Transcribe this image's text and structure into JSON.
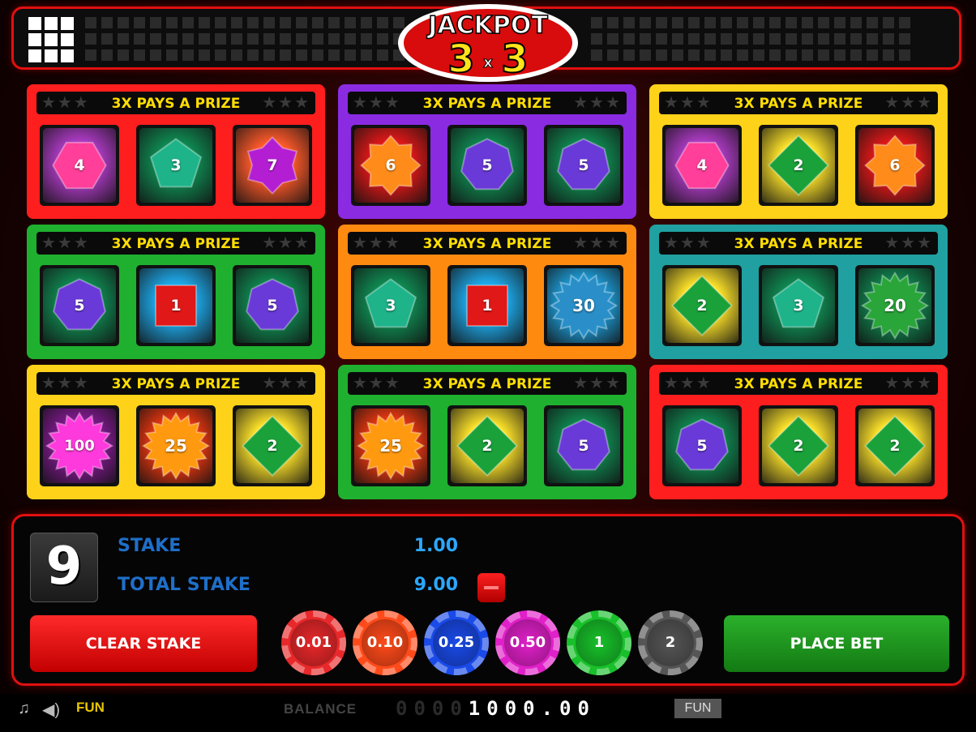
{
  "logo": {
    "line1": "JACKPOT",
    "line2a": "3",
    "line2x": "x",
    "line2b": "3"
  },
  "prize_text": "3X PAYS A PRIZE",
  "cards": [
    {
      "frame": "#ff1e1e",
      "cells": [
        {
          "shape": "hexagon",
          "color": "#ff3f9a",
          "value": "4"
        },
        {
          "shape": "pentagon",
          "color": "#1fb38a",
          "value": "3"
        },
        {
          "shape": "octagon",
          "color": "#b41ed2",
          "value": "7"
        }
      ]
    },
    {
      "frame": "#8a2be2",
      "cells": [
        {
          "shape": "star8",
          "color": "#ff8c1a",
          "value": "6"
        },
        {
          "shape": "heptagon",
          "color": "#6a3ad8",
          "value": "5"
        },
        {
          "shape": "heptagon",
          "color": "#6a3ad8",
          "value": "5"
        }
      ]
    },
    {
      "frame": "#ffd21a",
      "cells": [
        {
          "shape": "hexagon",
          "color": "#ff3f9a",
          "value": "4"
        },
        {
          "shape": "diamond",
          "color": "#1aa13a",
          "value": "2"
        },
        {
          "shape": "star8",
          "color": "#ff8c1a",
          "value": "6"
        }
      ]
    },
    {
      "frame": "#1fb02f",
      "cells": [
        {
          "shape": "heptagon",
          "color": "#6a3ad8",
          "value": "5"
        },
        {
          "shape": "square",
          "color": "#e01818",
          "value": "1"
        },
        {
          "shape": "heptagon",
          "color": "#6a3ad8",
          "value": "5"
        }
      ]
    },
    {
      "frame": "#ff8a10",
      "cells": [
        {
          "shape": "pentagon",
          "color": "#1fb38a",
          "value": "3"
        },
        {
          "shape": "square",
          "color": "#e01818",
          "value": "1"
        },
        {
          "shape": "burst",
          "color": "#2a8fc8",
          "value": "30"
        }
      ]
    },
    {
      "frame": "#20a0a0",
      "cells": [
        {
          "shape": "diamond",
          "color": "#1aa13a",
          "value": "2"
        },
        {
          "shape": "pentagon",
          "color": "#1fb38a",
          "value": "3"
        },
        {
          "shape": "burst",
          "color": "#2aa53a",
          "value": "20"
        }
      ]
    },
    {
      "frame": "#ffd21a",
      "cells": [
        {
          "shape": "burst",
          "color": "#ff3adc",
          "value": "100"
        },
        {
          "shape": "burst",
          "color": "#ff9a10",
          "value": "25"
        },
        {
          "shape": "diamond",
          "color": "#1aa13a",
          "value": "2"
        }
      ]
    },
    {
      "frame": "#1fb02f",
      "cells": [
        {
          "shape": "burst",
          "color": "#ff9a10",
          "value": "25"
        },
        {
          "shape": "diamond",
          "color": "#1aa13a",
          "value": "2"
        },
        {
          "shape": "heptagon",
          "color": "#6a3ad8",
          "value": "5"
        }
      ]
    },
    {
      "frame": "#ff1e1e",
      "cells": [
        {
          "shape": "heptagon",
          "color": "#6a3ad8",
          "value": "5"
        },
        {
          "shape": "diamond",
          "color": "#1aa13a",
          "value": "2"
        },
        {
          "shape": "diamond",
          "color": "#1aa13a",
          "value": "2"
        }
      ]
    }
  ],
  "backgrounds": {
    "hexagon": "#b03cc8",
    "pentagon": "#0f8a52",
    "octagon": "#ff5a2a",
    "star8": "#e81818",
    "heptagon": "#0f8a52",
    "diamond": "#ffe42a",
    "square": "#1ea8e8",
    "burst100": "#8a1a9a"
  },
  "panel": {
    "lines": "9",
    "stake_label": "STAKE",
    "stake_value": "1.00",
    "total_label": "TOTAL STAKE",
    "total_value": "9.00",
    "clear_label": "CLEAR STAKE",
    "place_label": "PLACE BET",
    "chips": [
      {
        "label": "0.01",
        "color": "#e8282a"
      },
      {
        "label": "0.10",
        "color": "#ff4a1a"
      },
      {
        "label": "0.25",
        "color": "#1a4ae8"
      },
      {
        "label": "0.50",
        "color": "#e020c8"
      },
      {
        "label": "1",
        "color": "#18c02a"
      },
      {
        "label": "2",
        "color": "#555555"
      }
    ]
  },
  "footer": {
    "music_icon": "music-icon",
    "sound_icon": "speaker-icon",
    "mode": "FUN",
    "balance_label": "BALANCE",
    "balance_dim": "0000",
    "balance_value": "1000.00",
    "currency": "FUN"
  }
}
